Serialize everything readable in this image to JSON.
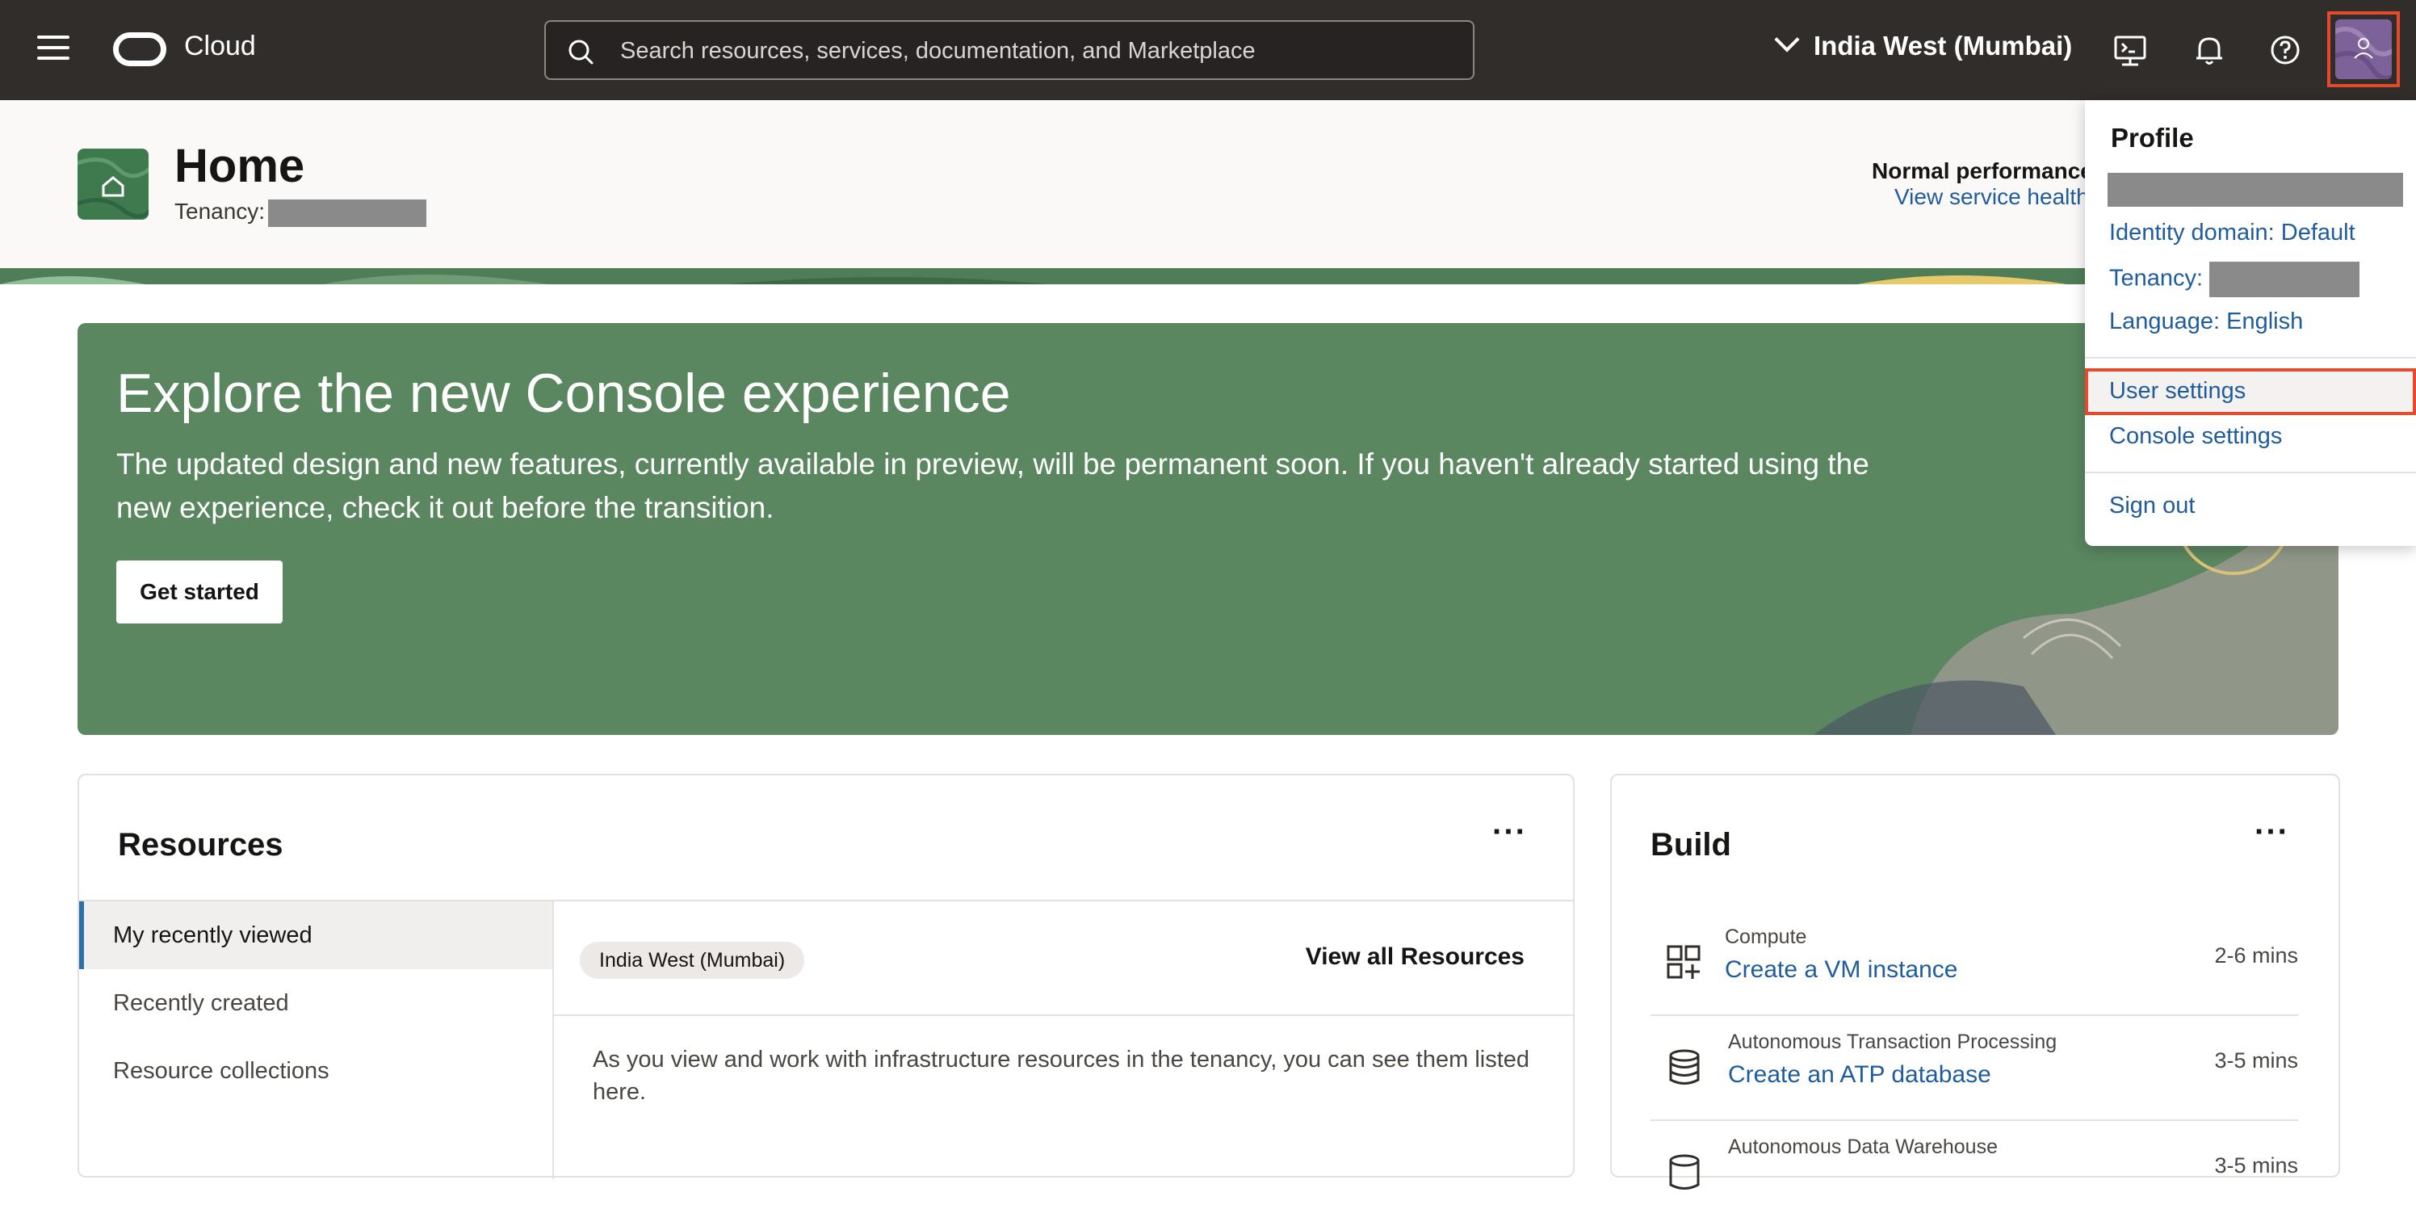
{
  "topbar": {
    "brand": "Cloud",
    "search_placeholder": "Search resources, services, documentation, and Marketplace",
    "region": "India West (Mumbai)"
  },
  "header": {
    "title": "Home",
    "tenancy_label": "Tenancy:",
    "status_title": "Normal performance",
    "status_link": "View service health"
  },
  "banner": {
    "title": "Explore the new Console experience",
    "body": "The updated design and new features, currently available in preview, will be permanent soon. If you haven't already started using the new experience, check it out before the transition.",
    "button": "Get started"
  },
  "resources": {
    "title": "Resources",
    "more": "···",
    "nav": [
      "My recently viewed",
      "Recently created",
      "Resource collections"
    ],
    "region_chip": "India West (Mumbai)",
    "view_all": "View all Resources",
    "empty_text": "As you view and work with infrastructure resources in the tenancy, you can see them listed here."
  },
  "build": {
    "title": "Build",
    "more": "···",
    "items": [
      {
        "category": "Compute",
        "link": "Create a VM instance",
        "time": "2-6 mins",
        "icon": "grid-plus-icon"
      },
      {
        "category": "Autonomous Transaction Processing",
        "link": "Create an ATP database",
        "time": "3-5 mins",
        "icon": "database-icon"
      },
      {
        "category": "Autonomous Data Warehouse",
        "link": "",
        "time": "3-5 mins",
        "icon": "database-icon"
      }
    ]
  },
  "profile_menu": {
    "title": "Profile",
    "identity_domain": "Identity domain: Default",
    "tenancy": "Tenancy:",
    "language": "Language: English",
    "user_settings": "User settings",
    "console_settings": "Console settings",
    "sign_out": "Sign out"
  },
  "colors": {
    "topbar": "#312d2a",
    "banner": "#5a8660",
    "link": "#1f5c9e",
    "highlight": "#e44a2b",
    "avatar": "#7d6199"
  }
}
